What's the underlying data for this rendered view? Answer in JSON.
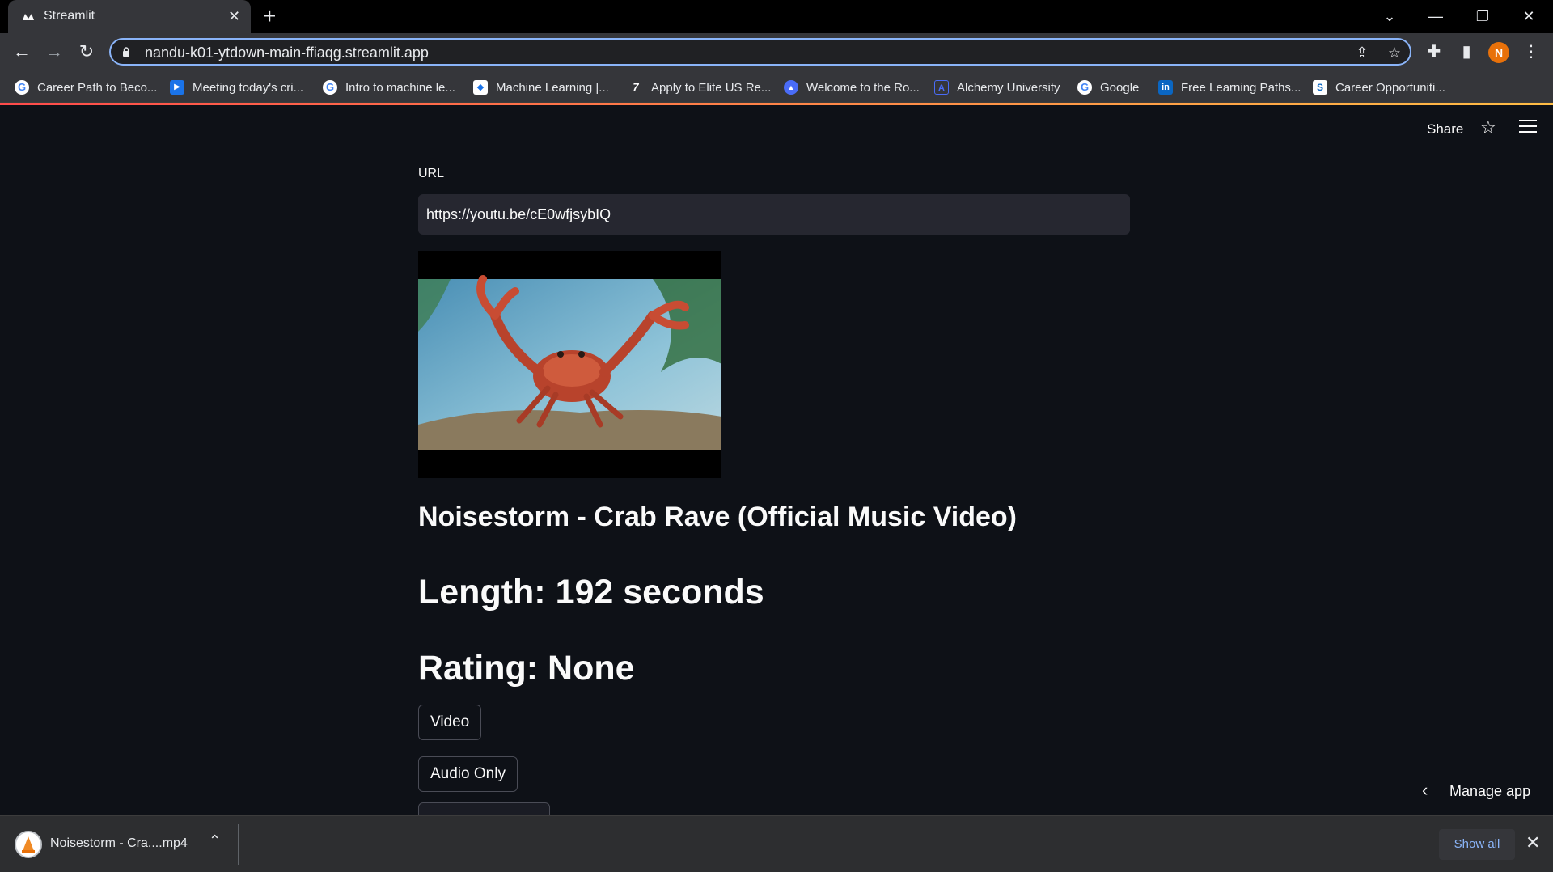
{
  "browser": {
    "tab_title": "Streamlit",
    "tab_close": "✕",
    "new_tab": "+",
    "url": "nandu-k01-ytdown-main-ffiaqg.streamlit.app",
    "avatar_letter": "N",
    "window_controls": {
      "minimize": "—",
      "restore": "❐",
      "close": "✕",
      "tab_search": "⌄"
    },
    "bookmarks": [
      {
        "label": "Career Path to Beco...",
        "icon": "google-icon",
        "color": "#4285f4",
        "glyph": "G"
      },
      {
        "label": "Meeting today's cri...",
        "icon": "video-play-icon",
        "color": "#1a73e8",
        "glyph": "▶"
      },
      {
        "label": "Intro to machine le...",
        "icon": "google-icon",
        "color": "#4285f4",
        "glyph": "G"
      },
      {
        "label": "Machine Learning |...",
        "icon": "course-icon",
        "color": "#e8eaed",
        "glyph": "◆"
      },
      {
        "label": "Apply to Elite US Re...",
        "icon": "seven-icon",
        "color": "#35363a",
        "glyph": "7"
      },
      {
        "label": "Welcome to the Ro...",
        "icon": "triangle-icon",
        "color": "#4a6cf7",
        "glyph": "▲"
      },
      {
        "label": "Alchemy University",
        "icon": "alchemy-icon",
        "color": "#35363a",
        "glyph": "A"
      },
      {
        "label": "Google",
        "icon": "google-icon",
        "color": "#4285f4",
        "glyph": "G"
      },
      {
        "label": "Free Learning Paths...",
        "icon": "linkedin-icon",
        "color": "#0a66c2",
        "glyph": "in"
      },
      {
        "label": "Career Opportuniti...",
        "icon": "career-icon",
        "color": "#e8eaed",
        "glyph": "S"
      }
    ]
  },
  "app": {
    "share_label": "Share",
    "url_label": "URL",
    "url_value": "https://youtu.be/cE0wfjsybIQ",
    "video_title": "Noisestorm - Crab Rave (Official Music Video)",
    "length_text": "Length: 192 seconds",
    "rating_text": "Rating: None",
    "buttons": {
      "video": "Video",
      "audio": "Audio Only"
    },
    "manage_app": "Manage app"
  },
  "downloads": {
    "file_name": "Noisestorm - Cra....mp4",
    "show_all": "Show all"
  },
  "colors": {
    "app_bg": "#0e1117",
    "input_bg": "#262730",
    "accent": "#8ab4f8",
    "avatar": "#e8710a"
  }
}
